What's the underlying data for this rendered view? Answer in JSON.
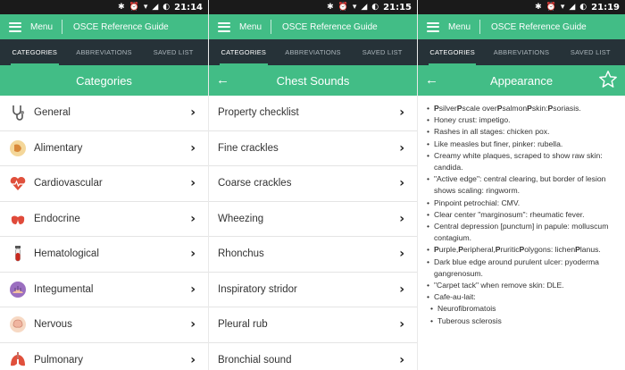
{
  "status": {
    "time_1": "21:14",
    "time_2": "21:15",
    "time_3": "21:19"
  },
  "appbar": {
    "menu_label": "Menu",
    "title": "OSCE Reference Guide"
  },
  "tabs": [
    "CATEGORIES",
    "ABBREVIATIONS",
    "SAVED LIST"
  ],
  "screen1": {
    "header": "Categories",
    "items": [
      {
        "label": "General",
        "icon": "stethoscope-icon"
      },
      {
        "label": "Alimentary",
        "icon": "stomach-icon"
      },
      {
        "label": "Cardiovascular",
        "icon": "heart-icon"
      },
      {
        "label": "Endocrine",
        "icon": "thyroid-icon"
      },
      {
        "label": "Hematological",
        "icon": "blood-tube-icon"
      },
      {
        "label": "Integumental",
        "icon": "skin-icon"
      },
      {
        "label": "Nervous",
        "icon": "brain-icon"
      },
      {
        "label": "Pulmonary",
        "icon": "lungs-icon"
      }
    ]
  },
  "screen2": {
    "header": "Chest Sounds",
    "items": [
      "Property checklist",
      "Fine crackles",
      "Coarse crackles",
      "Wheezing",
      "Rhonchus",
      "Inspiratory stridor",
      "Pleural rub",
      "Bronchial sound"
    ]
  },
  "screen3": {
    "header": "Appearance",
    "lines": [
      "Honey crust: impetigo.",
      "Rashes in all stages: chicken pox.",
      "Like measles but finer, pinker: rubella.",
      "Creamy white plaques, scraped to show raw skin: candida.",
      "\"Active edge\": central clearing, but border of lesion shows scaling: ringworm.",
      "Pinpoint petrochial: CMV.",
      "Clear center \"marginosum\": rheumatic fever.",
      "Central depression [punctum] in papule: molluscum contagium.",
      "Dark blue edge around purulent ulcer: pyoderma gangrenosum.",
      "\"Carpet tack\" when remove skin: DLE.",
      "Cafe-au-lait:",
      "Neurofibromatois",
      "Tuberous sclerosis"
    ],
    "mnemonic_1": [
      "P",
      "silver",
      "P",
      "scale over",
      "P",
      "salmon",
      "P",
      "skin:",
      "P",
      "soriasis."
    ],
    "mnemonic_2": [
      "P",
      "urple,",
      "P",
      "eripheral,",
      "P",
      "ruritic",
      "P",
      "olygons: lichen",
      "P",
      "lanus."
    ]
  },
  "colors": {
    "accent": "#42bd86",
    "tabbar": "#263238",
    "statusbar": "#1a1a1a"
  }
}
